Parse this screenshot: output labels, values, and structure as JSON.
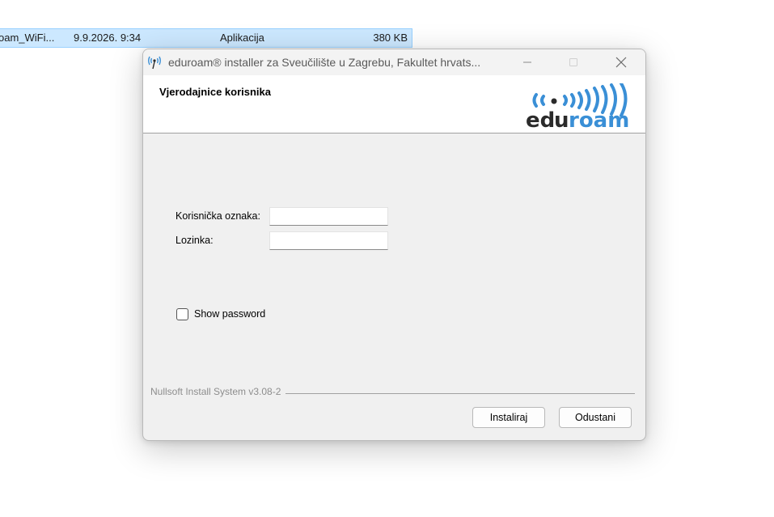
{
  "explorer_row": {
    "name": "oam_WiFi...",
    "date": "9.9.2026. 9:34",
    "type": "Aplikacija",
    "size": "380 KB"
  },
  "window": {
    "title": "eduroam® installer za Sveučilište u Zagrebu, Fakultet hrvats...",
    "icon": "eduroam-antenna-icon",
    "controls": {
      "minimize": "minimize-icon",
      "maximize": "maximize-icon",
      "close": "close-icon"
    }
  },
  "header": {
    "title": "Vjerodajnice korisnika",
    "logo": {
      "text_prefix": "ed",
      "text_suffix": "roam",
      "text_u": "u"
    }
  },
  "form": {
    "username_label": "Korisnička oznaka:",
    "username_value": "",
    "password_label": "Lozinka:",
    "password_value": "",
    "show_password_label": "Show password",
    "show_password_checked": false
  },
  "footer": {
    "branding": "Nullsoft Install System v3.08-2",
    "install_label": "Instaliraj",
    "cancel_label": "Odustani"
  },
  "colors": {
    "logo_blue": "#3a8fd6",
    "logo_dark": "#2b2b2b",
    "selection": "#cce8ff"
  }
}
